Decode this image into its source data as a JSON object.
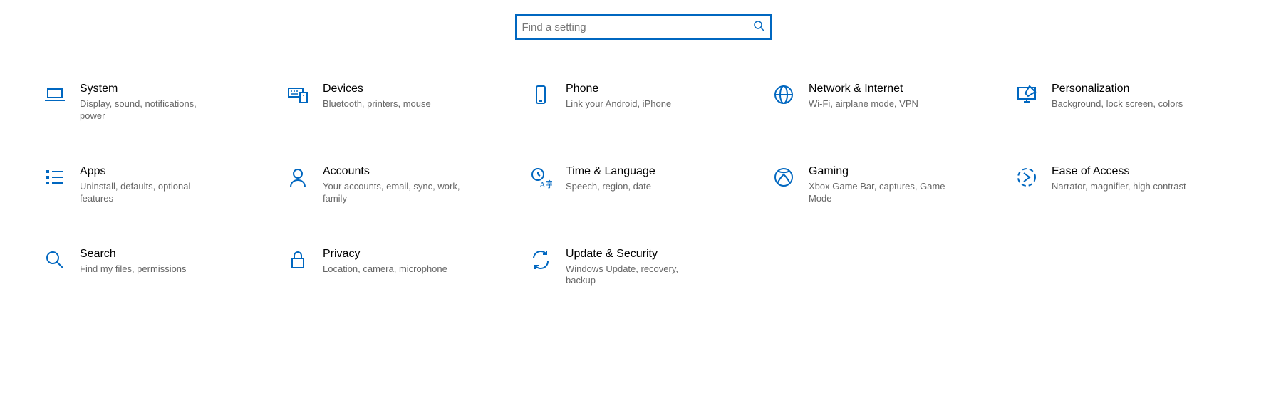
{
  "search": {
    "placeholder": "Find a setting"
  },
  "tiles": [
    {
      "id": "system",
      "icon": "laptop-icon",
      "title": "System",
      "desc": "Display, sound, notifications, power"
    },
    {
      "id": "devices",
      "icon": "keyboard-icon",
      "title": "Devices",
      "desc": "Bluetooth, printers, mouse"
    },
    {
      "id": "phone",
      "icon": "phone-icon",
      "title": "Phone",
      "desc": "Link your Android, iPhone"
    },
    {
      "id": "network",
      "icon": "globe-icon",
      "title": "Network & Internet",
      "desc": "Wi-Fi, airplane mode, VPN"
    },
    {
      "id": "personalization",
      "icon": "pen-monitor-icon",
      "title": "Personalization",
      "desc": "Background, lock screen, colors"
    },
    {
      "id": "apps",
      "icon": "list-icon",
      "title": "Apps",
      "desc": "Uninstall, defaults, optional features"
    },
    {
      "id": "accounts",
      "icon": "person-icon",
      "title": "Accounts",
      "desc": "Your accounts, email, sync, work, family"
    },
    {
      "id": "time",
      "icon": "time-language-icon",
      "title": "Time & Language",
      "desc": "Speech, region, date"
    },
    {
      "id": "gaming",
      "icon": "xbox-icon",
      "title": "Gaming",
      "desc": "Xbox Game Bar, captures, Game Mode"
    },
    {
      "id": "ease",
      "icon": "ease-of-access-icon",
      "title": "Ease of Access",
      "desc": "Narrator, magnifier, high contrast"
    },
    {
      "id": "searchcat",
      "icon": "magnifier-icon",
      "title": "Search",
      "desc": "Find my files, permissions"
    },
    {
      "id": "privacy",
      "icon": "lock-icon",
      "title": "Privacy",
      "desc": "Location, camera, microphone"
    },
    {
      "id": "update",
      "icon": "sync-icon",
      "title": "Update & Security",
      "desc": "Windows Update, recovery, backup"
    }
  ],
  "colors": {
    "accent": "#0067c0"
  }
}
